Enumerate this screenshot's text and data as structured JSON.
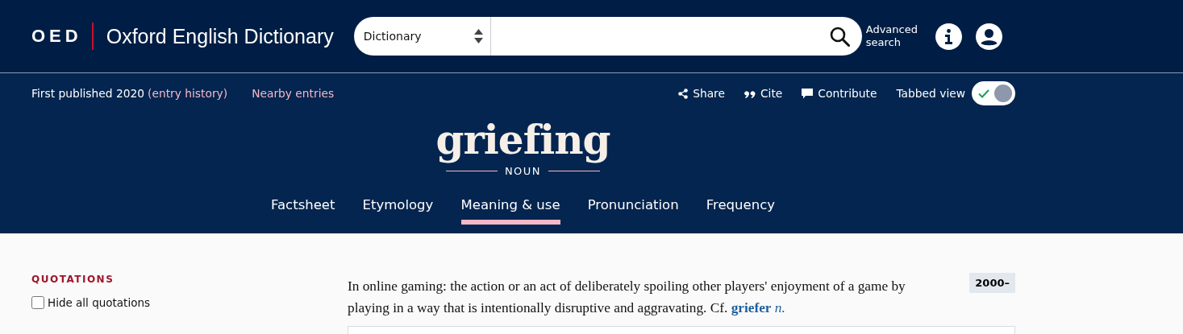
{
  "header": {
    "logo_abbr": "OED",
    "logo_name": "Oxford English Dictionary",
    "search": {
      "scope": "Dictionary"
    },
    "advanced_search": "Advanced search"
  },
  "entry_bar": {
    "published": "First published 2020",
    "history_link": "(entry history)",
    "nearby": "Nearby entries",
    "actions": [
      {
        "kind": "share",
        "label": "Share"
      },
      {
        "kind": "cite",
        "label": "Cite"
      },
      {
        "kind": "contribute",
        "label": "Contribute"
      }
    ],
    "tabbed_view": {
      "label": "Tabbed view",
      "on": true
    }
  },
  "headword": {
    "word": "griefing",
    "part_of_speech": "NOUN"
  },
  "tabs": [
    {
      "label": "Factsheet",
      "selected": false
    },
    {
      "label": "Etymology",
      "selected": false
    },
    {
      "label": "Meaning & use",
      "selected": true
    },
    {
      "label": "Pronunciation",
      "selected": false
    },
    {
      "label": "Frequency",
      "selected": false
    }
  ],
  "sidebar": {
    "heading": "QUOTATIONS",
    "hide_quotations": {
      "label": "Hide all quotations",
      "checked": false
    }
  },
  "definition": {
    "text": "In online gaming: the action or an act of deliberately spoiling other players' enjoyment of a game by playing in a way that is intentionally disruptive and aggravating. Cf.",
    "link": "griefer",
    "suffix": "n.",
    "date": "2000–"
  }
}
